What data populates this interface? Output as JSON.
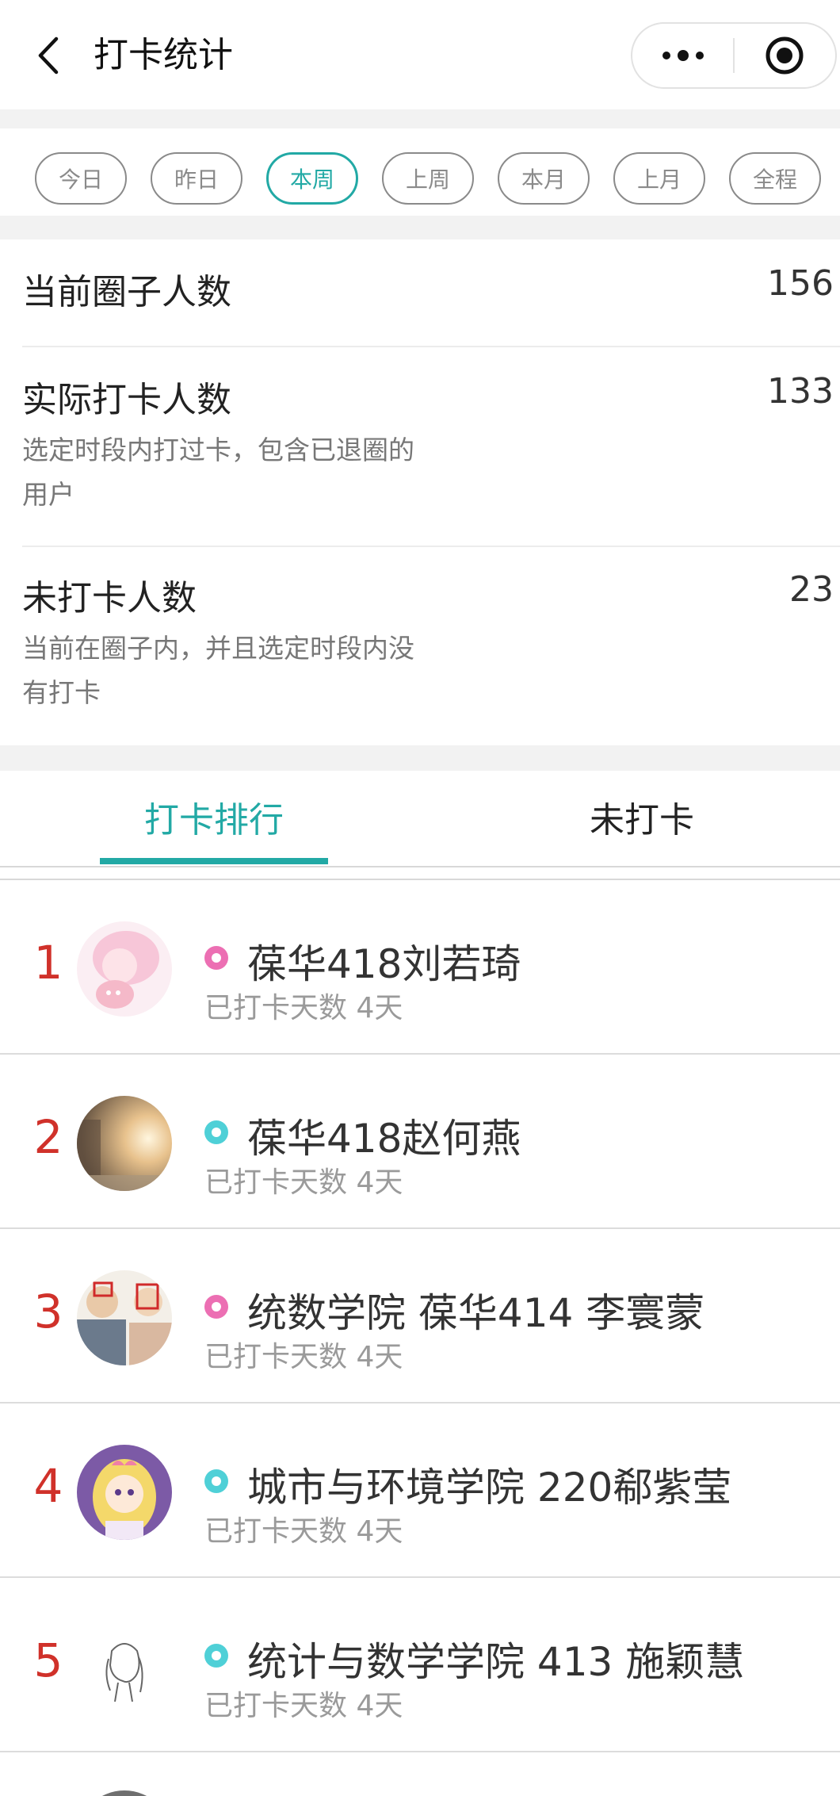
{
  "navbar": {
    "title": "打卡统计"
  },
  "filters": [
    {
      "label": "今日",
      "active": false
    },
    {
      "label": "昨日",
      "active": false
    },
    {
      "label": "本周",
      "active": true
    },
    {
      "label": "上周",
      "active": false
    },
    {
      "label": "本月",
      "active": false
    },
    {
      "label": "上月",
      "active": false
    },
    {
      "label": "全程",
      "active": false
    }
  ],
  "stats": {
    "members": {
      "label": "当前圈子人数",
      "value": "156"
    },
    "checked": {
      "label": "实际打卡人数",
      "value": "133",
      "desc": "选定时段内打过卡，包含已退圈的用户"
    },
    "unchecked": {
      "label": "未打卡人数",
      "value": "23",
      "desc": "当前在圈子内，并且选定时段内没有打卡"
    }
  },
  "tabs": [
    {
      "label": "打卡排行",
      "active": true
    },
    {
      "label": "未打卡",
      "active": false
    }
  ],
  "colors": {
    "accent": "#22a9a5",
    "rank": "#d0312a",
    "female": "#ec6fb3",
    "male": "#4fd0d7"
  },
  "ranking": [
    {
      "rank": "1",
      "name": "葆华418刘若琦",
      "days": "已打卡天数 4天",
      "gender": "female"
    },
    {
      "rank": "2",
      "name": "葆华418赵何燕",
      "days": "已打卡天数 4天",
      "gender": "male"
    },
    {
      "rank": "3",
      "name": "统数学院 葆华414 李寰蒙",
      "days": "已打卡天数 4天",
      "gender": "female"
    },
    {
      "rank": "4",
      "name": "城市与环境学院 220郗紫莹",
      "days": "已打卡天数 4天",
      "gender": "male"
    },
    {
      "rank": "5",
      "name": "统计与数学学院 413 施颖慧",
      "days": "已打卡天数 4天",
      "gender": "male"
    }
  ]
}
